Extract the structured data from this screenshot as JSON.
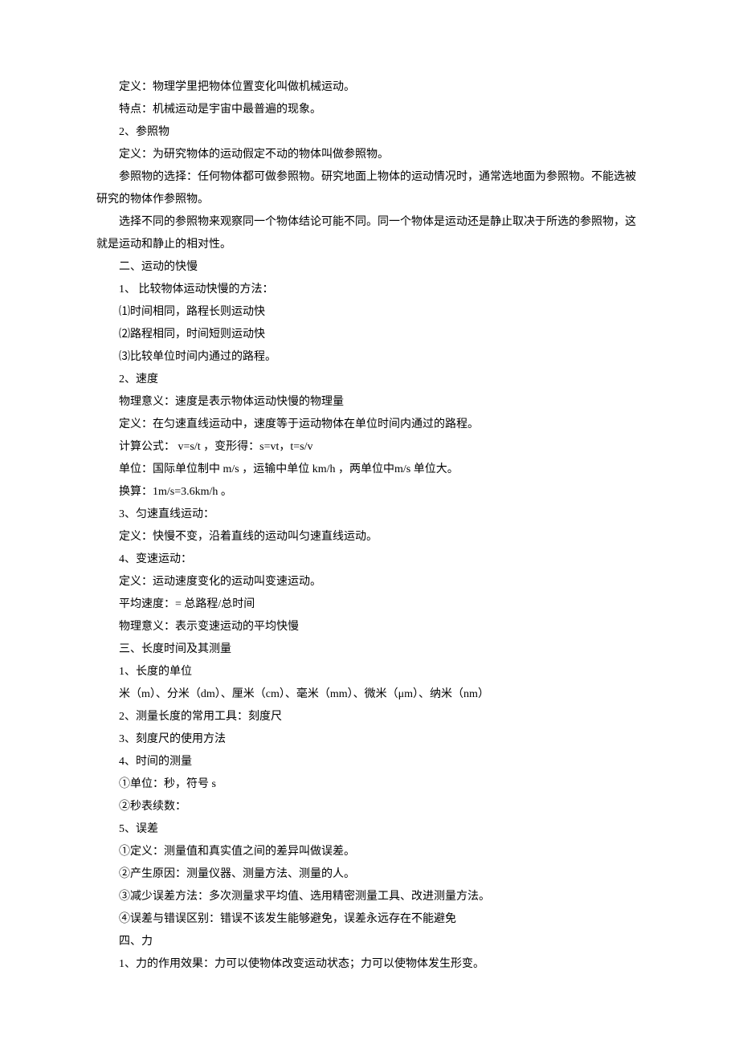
{
  "lines": [
    "定义：物理学里把物体位置变化叫做机械运动。",
    "特点：机械运动是宇宙中最普遍的现象。",
    "2、参照物",
    "定义：为研究物体的运动假定不动的物体叫做参照物。",
    "参照物的选择：任何物体都可做参照物。研究地面上物体的运动情况时，通常选地面为参照物。不能选被研究的物体作参照物。",
    "选择不同的参照物来观察同一个物体结论可能不同。同一个物体是运动还是静止取决于所选的参照物，这就是运动和静止的相对性。",
    "二、运动的快慢",
    "1、 比较物体运动快慢的方法：",
    "⑴时间相同，路程长则运动快",
    "⑵路程相同，时间短则运动快",
    "⑶比较单位时间内通过的路程。",
    "2、速度",
    "物理意义：速度是表示物体运动快慢的物理量",
    "定义：在匀速直线运动中，速度等于运动物体在单位时间内通过的路程。",
    "计算公式： v=s/t ，变形得：s=vt，t=s/v",
    "单位：国际单位制中 m/s ，运输中单位 km/h ，两单位中m/s 单位大。",
    "换算：1m/s=3.6km/h 。",
    "3、匀速直线运动：",
    "定义：快慢不变，沿着直线的运动叫匀速直线运动。",
    "4、变速运动：",
    "定义：运动速度变化的运动叫变速运动。",
    "平均速度：= 总路程/总时间",
    "物理意义：表示变速运动的平均快慢",
    "三、长度时间及其测量",
    "1、长度的单位",
    "米（m）、分米（dm）、厘米（cm）、毫米（mm）、微米（μm）、纳米（nm）",
    "2、测量长度的常用工具：刻度尺",
    "3、刻度尺的使用方法",
    "4、时间的测量",
    "①单位：秒，符号 s",
    "②秒表续数：",
    "5、误差",
    "①定义：测量值和真实值之间的差异叫做误差。",
    "②产生原因：测量仪器、测量方法、测量的人。",
    "③减少误差方法：多次测量求平均值、选用精密测量工具、改进测量方法。",
    "④误差与错误区别：错误不该发生能够避免，误差永远存在不能避免",
    "四、力",
    "1、力的作用效果：力可以使物体改变运动状态；力可以使物体发生形变。"
  ]
}
